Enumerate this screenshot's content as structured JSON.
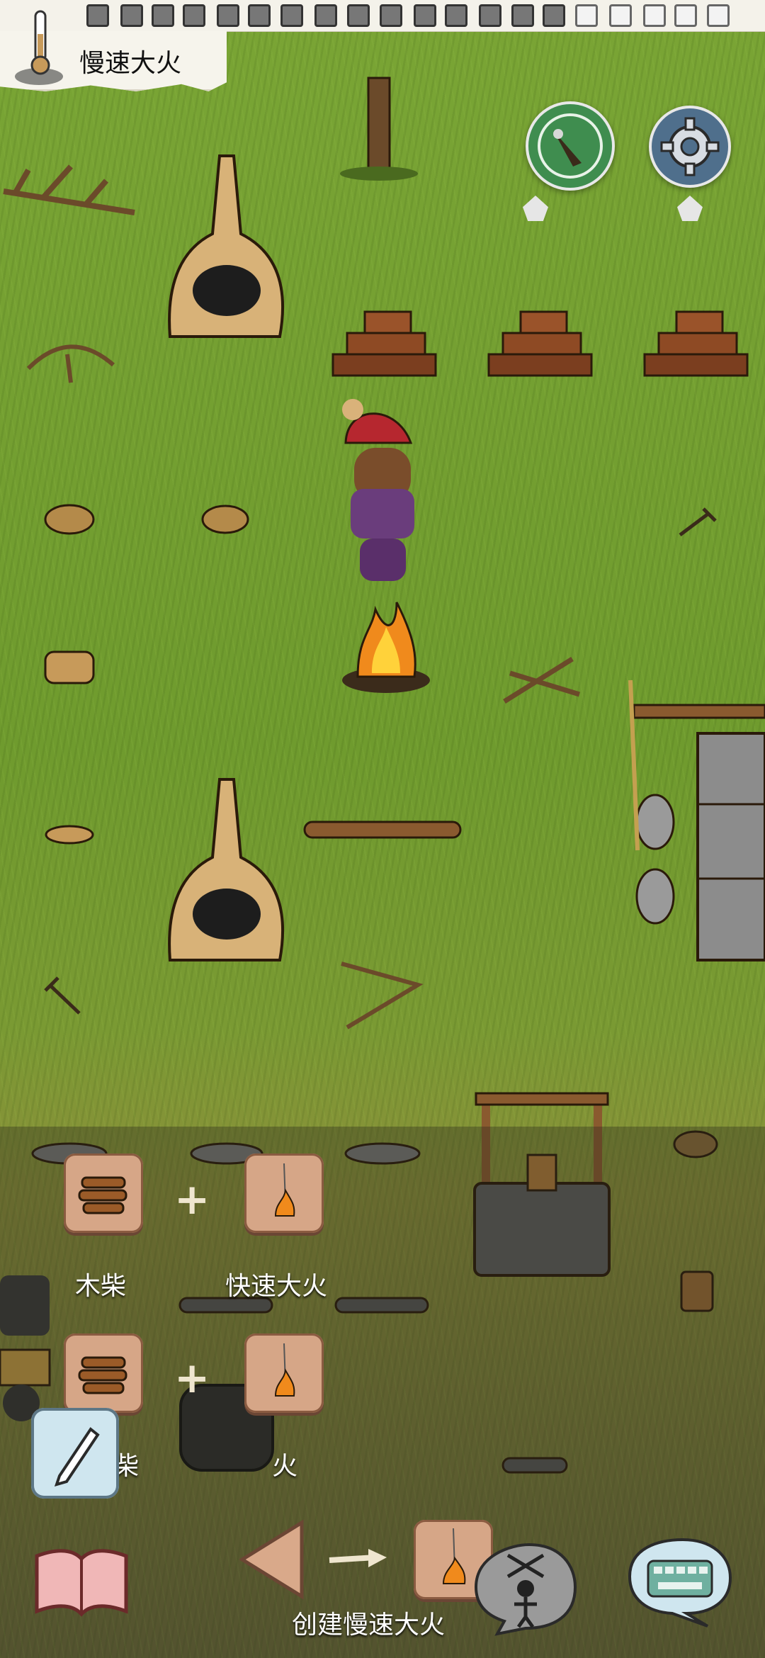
{
  "top_bar": {
    "action_title": "慢速大火",
    "checkbox_count": 22
  },
  "hud": {
    "compass_icon": "compass-icon",
    "settings_icon": "gear-icon",
    "temperature_icon": "thermometer-icon"
  },
  "recipe_panel": {
    "rows": [
      {
        "ingredient_a": "木柴",
        "ingredient_b": "快速大火"
      },
      {
        "ingredient_a": "柴",
        "ingredient_b": "火"
      }
    ],
    "result_label": "创建慢速大火"
  },
  "colors": {
    "grass": "#7aa535",
    "tile": "#d6a687",
    "compass_button": "#3f8d4f",
    "gear_button": "#4f6f8c"
  }
}
